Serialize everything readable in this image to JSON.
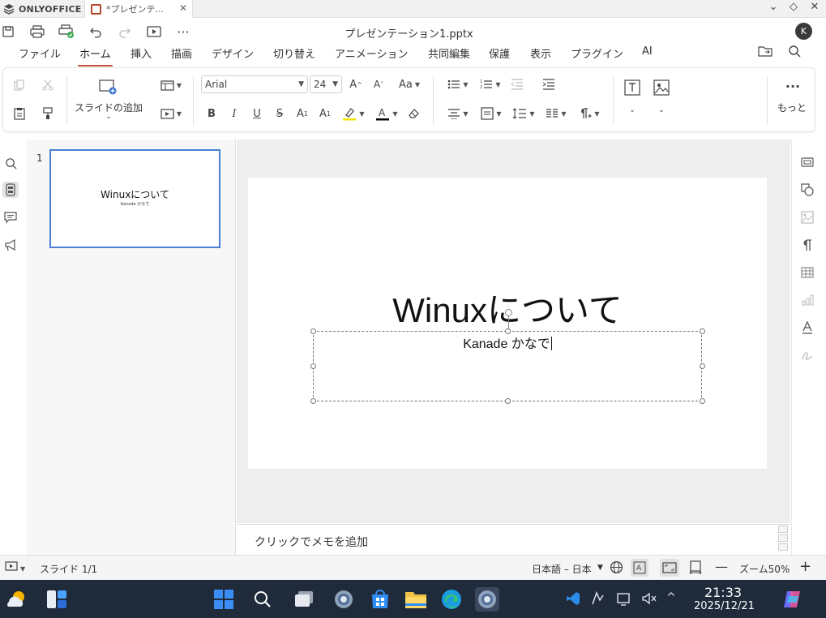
{
  "app": {
    "brand": "ONLYOFFICE",
    "tab_title": "*プレゼンテ...",
    "doc_title": "プレゼンテーション1.pptx",
    "avatar_initial": "K"
  },
  "menu": {
    "items": [
      "ファイル",
      "ホーム",
      "挿入",
      "描画",
      "デザイン",
      "切り替え",
      "アニメーション",
      "共同編集",
      "保護",
      "表示",
      "プラグイン",
      "AI"
    ],
    "active": "ホーム"
  },
  "ribbon": {
    "add_slide_label": "スライドの追加",
    "font_name": "Arial",
    "font_size": "24",
    "more_label": "もっと",
    "accent_underline_color": "#c64b3b",
    "highlight_color": "#f2e600",
    "font_color": "#000000"
  },
  "slides_panel": {
    "slide_number": "1",
    "thumb_title": "Winuxについて",
    "thumb_subtitle": "Kanade かなで"
  },
  "slide": {
    "title": "Winuxについて",
    "subtitle": "Kanade かなで"
  },
  "notes": {
    "placeholder": "クリックでメモを追加"
  },
  "statusbar": {
    "slide_info": "スライド 1/1",
    "language": "日本語 – 日本",
    "zoom": "ズーム50%"
  },
  "taskbar": {
    "time": "21:33",
    "date": "2025/12/21"
  }
}
